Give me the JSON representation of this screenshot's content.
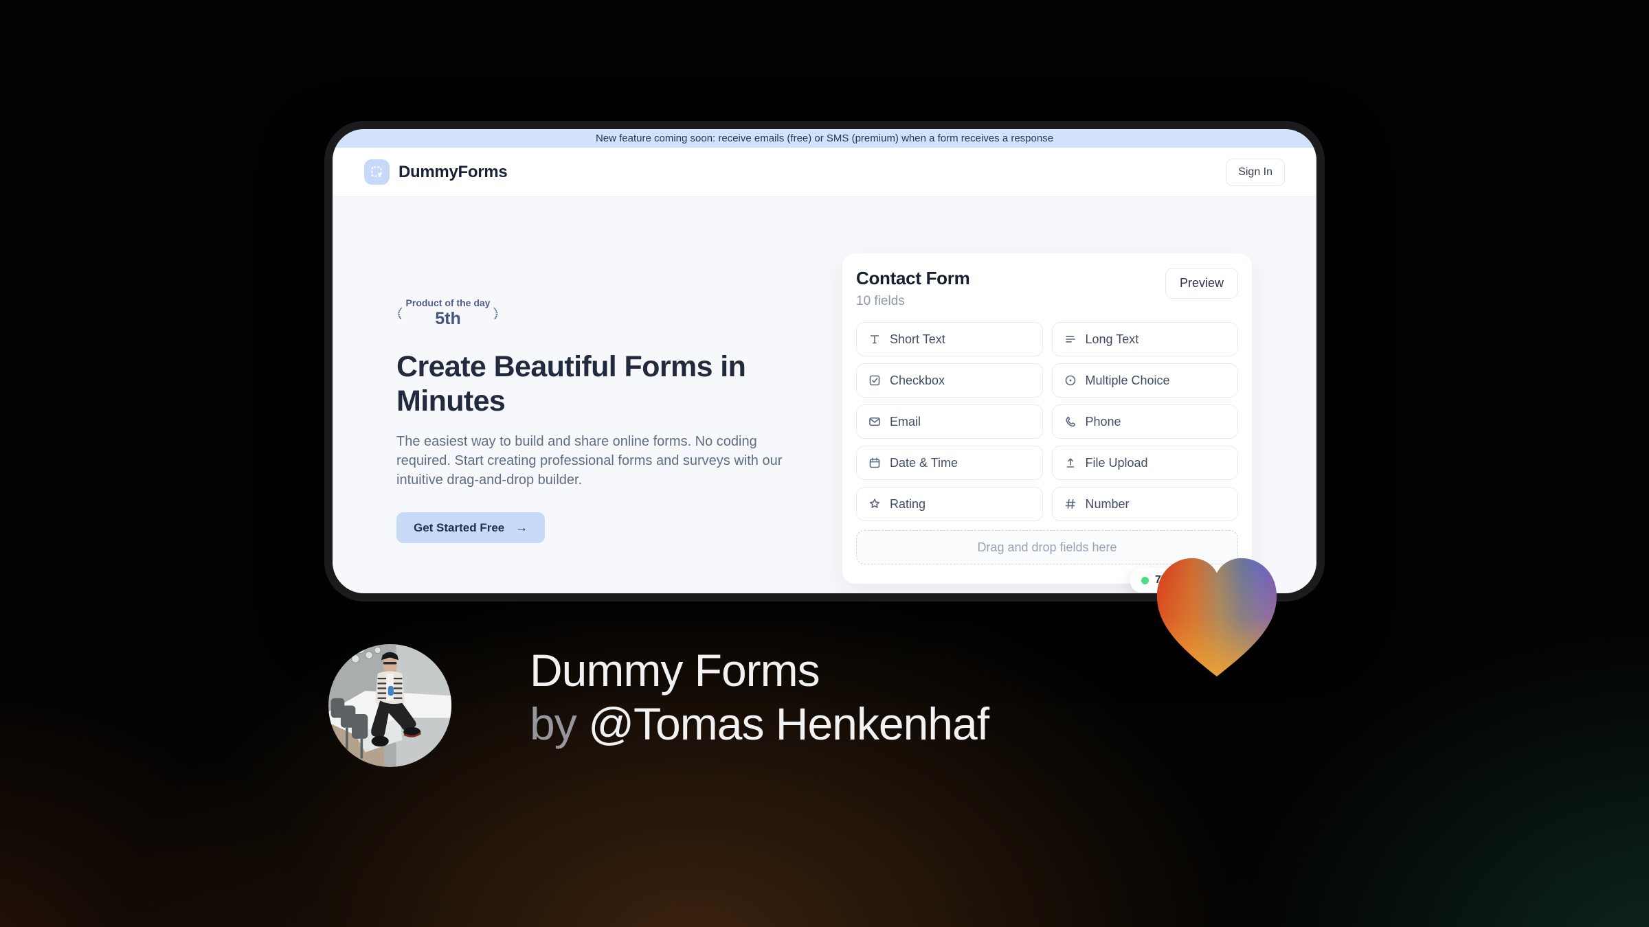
{
  "banner": {
    "text": "New feature coming soon: receive emails (free) or SMS (premium) when a form receives a response"
  },
  "header": {
    "brand": "DummyForms",
    "sign_in_label": "Sign In"
  },
  "hero": {
    "badge": {
      "line1": "Product of the day",
      "line2": "5th"
    },
    "title": "Create Beautiful Forms in Minutes",
    "description": "The easiest way to build and share online forms. No coding required. Start creating professional forms and surveys with our intuitive drag-and-drop builder.",
    "cta_label": "Get Started Free",
    "cta_arrow": "→"
  },
  "form_builder": {
    "title": "Contact Form",
    "subtitle": "10 fields",
    "preview_label": "Preview",
    "fields": [
      {
        "label": "Short Text",
        "icon": "short-text-icon"
      },
      {
        "label": "Long Text",
        "icon": "long-text-icon"
      },
      {
        "label": "Checkbox",
        "icon": "checkbox-icon"
      },
      {
        "label": "Multiple Choice",
        "icon": "multiple-choice-icon"
      },
      {
        "label": "Email",
        "icon": "email-icon"
      },
      {
        "label": "Phone",
        "icon": "phone-icon"
      },
      {
        "label": "Date & Time",
        "icon": "calendar-icon"
      },
      {
        "label": "File Upload",
        "icon": "upload-icon"
      },
      {
        "label": "Rating",
        "icon": "star-icon"
      },
      {
        "label": "Number",
        "icon": "hash-icon"
      }
    ],
    "dropzone_text": "Drag and drop fields here",
    "status_badge": {
      "text": "77",
      "dot_color": "#4ade80"
    }
  },
  "caption": {
    "line1": "Dummy Forms",
    "by": "by",
    "author": "@Tomas Henkenhaf"
  },
  "colors": {
    "accent_blue": "#c9daf8",
    "banner_bg": "#d3e2fb",
    "navy_text": "#222b3e",
    "page_bg": "#f7f8fb",
    "wreath": "#4d5d87",
    "status_green": "#4ade80",
    "heart_red": "#d63a1c",
    "heart_orange": "#f09c30",
    "heart_purple": "#7757bd"
  }
}
